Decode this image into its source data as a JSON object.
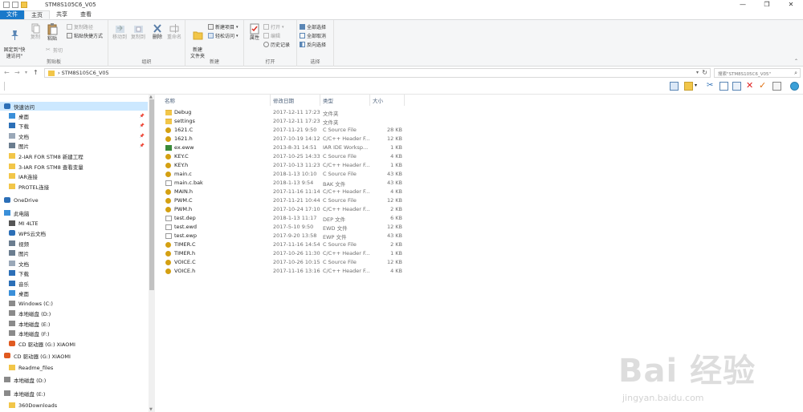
{
  "window": {
    "title": "STM8S105C6_V05",
    "controls": [
      "—",
      "❐",
      "✕"
    ]
  },
  "tabs": [
    "文件",
    "主页",
    "共享",
    "查看"
  ],
  "ribbon": {
    "clipboard": {
      "label": "剪贴板",
      "pin": "固定到\"快\n速访问\"",
      "copy": "复制",
      "paste": "粘贴",
      "copy_path": "复制路径",
      "paste_shortcut": "粘贴快捷方式",
      "cut": "剪切"
    },
    "organize": {
      "label": "组织",
      "move_to": "移动到",
      "copy_to": "复制到",
      "delete": "删除",
      "rename": "重命名"
    },
    "new": {
      "label": "新建",
      "new_folder": "新建\n文件夹",
      "new_item": "新建项目",
      "easy_access": "轻松访问"
    },
    "open": {
      "label": "打开",
      "properties": "属性",
      "open": "打开",
      "edit": "编辑",
      "history": "历史记录"
    },
    "select": {
      "label": "选择",
      "select_all": "全部选择",
      "select_none": "全部取消",
      "invert": "反向选择"
    }
  },
  "address": {
    "path": "STM8S105C6_V05",
    "search_placeholder": "搜索\"STM8S105C6_V05\""
  },
  "nav": {
    "items": [
      {
        "label": "快速访问",
        "icon": "star-icon",
        "selected": true
      },
      {
        "label": "桌面",
        "icon": "desktop-icon",
        "pinned": true
      },
      {
        "label": "下载",
        "icon": "download-icon",
        "pinned": true
      },
      {
        "label": "文档",
        "icon": "document-icon",
        "pinned": true
      },
      {
        "label": "图片",
        "icon": "picture-icon",
        "pinned": true
      },
      {
        "label": "2-IAR FOR STM8 新建工程",
        "icon": "folder-icon"
      },
      {
        "label": "3-IAR FOR STM8 查看变量",
        "icon": "folder-icon"
      },
      {
        "label": "IAR连接",
        "icon": "folder-icon"
      },
      {
        "label": "PROTEL连接",
        "icon": "folder-icon"
      },
      {
        "label": "OneDrive",
        "icon": "cloud-icon"
      },
      {
        "label": "此电脑",
        "icon": "computer-icon"
      },
      {
        "label": "MI 4LTE",
        "icon": "phone-icon"
      },
      {
        "label": "WPS云文档",
        "icon": "cloud-icon"
      },
      {
        "label": "视频",
        "icon": "video-icon"
      },
      {
        "label": "图片",
        "icon": "picture-icon"
      },
      {
        "label": "文档",
        "icon": "document-icon"
      },
      {
        "label": "下载",
        "icon": "download-icon"
      },
      {
        "label": "音乐",
        "icon": "music-icon"
      },
      {
        "label": "桌面",
        "icon": "desktop-icon"
      },
      {
        "label": "Windows (C:)",
        "icon": "drive-icon"
      },
      {
        "label": "本地磁盘 (D:)",
        "icon": "drive-icon"
      },
      {
        "label": "本地磁盘 (E:)",
        "icon": "drive-icon"
      },
      {
        "label": "本地磁盘 (F:)",
        "icon": "drive-icon"
      },
      {
        "label": "CD 驱动器 (G:) XIAOMI",
        "icon": "cd-icon"
      },
      {
        "label": "CD 驱动器 (G:) XIAOMI",
        "icon": "cd-icon"
      },
      {
        "label": "Readme_files",
        "icon": "folder-icon"
      },
      {
        "label": "本地磁盘 (D:)",
        "icon": "drive-icon"
      },
      {
        "label": "本地磁盘 (E:)",
        "icon": "drive-icon"
      },
      {
        "label": "360Downloads",
        "icon": "folder-icon"
      }
    ]
  },
  "list": {
    "headers": {
      "name": "名称",
      "date": "修改日期",
      "type": "类型",
      "size": "大小"
    },
    "files": [
      {
        "name": "Debug",
        "date": "2017-12-11 17:23",
        "type": "文件夹",
        "size": "",
        "icon": "folder"
      },
      {
        "name": "settings",
        "date": "2017-12-11 17:23",
        "type": "文件夹",
        "size": "",
        "icon": "folder"
      },
      {
        "name": "1621.C",
        "date": "2017-11-21 9:50",
        "type": "C Source File",
        "size": "28 KB",
        "icon": "c"
      },
      {
        "name": "1621.h",
        "date": "2017-10-19 14:12",
        "type": "C/C++ Header F...",
        "size": "12 KB",
        "icon": "h"
      },
      {
        "name": "ex.eww",
        "date": "2013-8-31 14:51",
        "type": "IAR IDE Worksp...",
        "size": "1 KB",
        "icon": "iar"
      },
      {
        "name": "KEY.C",
        "date": "2017-10-25 14:33",
        "type": "C Source File",
        "size": "4 KB",
        "icon": "c"
      },
      {
        "name": "KEY.h",
        "date": "2017-10-13 11:23",
        "type": "C/C++ Header F...",
        "size": "1 KB",
        "icon": "h"
      },
      {
        "name": "main.c",
        "date": "2018-1-13 10:10",
        "type": "C Source File",
        "size": "43 KB",
        "icon": "c"
      },
      {
        "name": "main.c.bak",
        "date": "2018-1-13 9:54",
        "type": "BAK 文件",
        "size": "43 KB",
        "icon": "doc"
      },
      {
        "name": "MAIN.h",
        "date": "2017-11-16 11:14",
        "type": "C/C++ Header F...",
        "size": "4 KB",
        "icon": "h"
      },
      {
        "name": "PWM.C",
        "date": "2017-11-21 10:44",
        "type": "C Source File",
        "size": "12 KB",
        "icon": "c"
      },
      {
        "name": "PWM.h",
        "date": "2017-10-24 17:10",
        "type": "C/C++ Header F...",
        "size": "2 KB",
        "icon": "h"
      },
      {
        "name": "test.dep",
        "date": "2018-1-13 11:17",
        "type": "DEP 文件",
        "size": "6 KB",
        "icon": "doc"
      },
      {
        "name": "test.ewd",
        "date": "2017-5-10 9:50",
        "type": "EWD 文件",
        "size": "12 KB",
        "icon": "doc"
      },
      {
        "name": "test.ewp",
        "date": "2017-9-20 13:58",
        "type": "EWP 文件",
        "size": "43 KB",
        "icon": "doc"
      },
      {
        "name": "TIMER.C",
        "date": "2017-11-16 14:54",
        "type": "C Source File",
        "size": "2 KB",
        "icon": "c"
      },
      {
        "name": "TIMER.h",
        "date": "2017-10-26 11:30",
        "type": "C/C++ Header F...",
        "size": "1 KB",
        "icon": "h"
      },
      {
        "name": "VOICE.C",
        "date": "2017-10-26 10:15",
        "type": "C Source File",
        "size": "12 KB",
        "icon": "c"
      },
      {
        "name": "VOICE.h",
        "date": "2017-11-16 13:16",
        "type": "C/C++ Header F...",
        "size": "4 KB",
        "icon": "h"
      }
    ]
  },
  "watermark": {
    "main": "Bai 经验",
    "sub": "jingyan.baidu.com"
  },
  "colors": {
    "accent": "#1979ca",
    "selected": "#cce8ff",
    "folder": "#f2c649"
  }
}
